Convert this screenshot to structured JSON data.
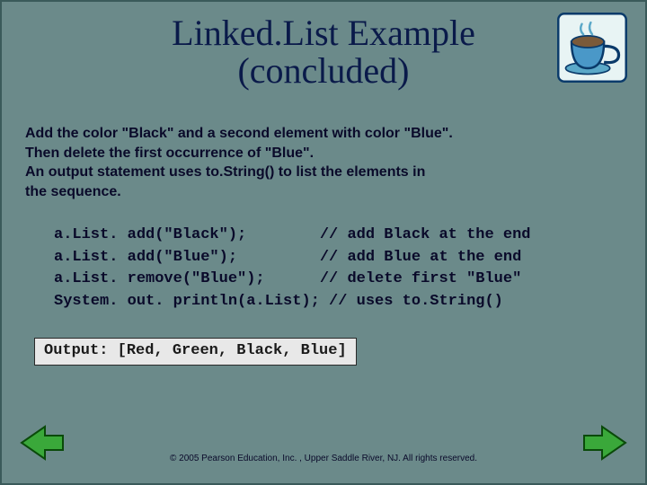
{
  "title": {
    "line1": "Linked.List Example",
    "line2": "(concluded)"
  },
  "description": {
    "line1": "Add the color \"Black\" and a second element with color \"Blue\".",
    "line2": "Then delete the first occurrence of \"Blue\".",
    "line3": "An output statement uses to.String() to list the elements in",
    "line4": "the sequence."
  },
  "code": {
    "l1": "a.List. add(\"Black\");        // add Black at the end",
    "l2": "a.List. add(\"Blue\");         // add Blue at the end",
    "l3": "a.List. remove(\"Blue\");      // delete first \"Blue\"",
    "l4": "System. out. println(a.List); // uses to.String()"
  },
  "output": {
    "label": "Output:",
    "value": "[Red, Green, Black, Blue]"
  },
  "footer": {
    "copyright": "© 2005 Pearson Education, Inc. , Upper Saddle River, NJ.  All rights reserved."
  },
  "icons": {
    "coffee": "coffee-cup-icon",
    "prev": "prev-arrow-icon",
    "next": "next-arrow-icon"
  }
}
